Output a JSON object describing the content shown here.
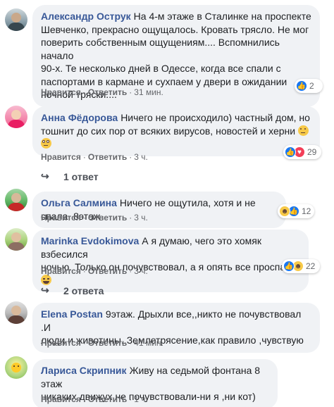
{
  "colors": {
    "author": "#385898",
    "bubble": "#f0f2f5",
    "meta": "#65676b",
    "like": "#1877f2",
    "love": "#f33e58",
    "haha": "#f7c948"
  },
  "comments": [
    {
      "author": "Александр Острук",
      "text_lines": [
        "На 4-м этаже в Сталинке на проспекте",
        "Шевченко, прекрасно ощущалось. Кровать трясло. Не мог",
        "поверить собственным ощущениям.... Вспомнились начало",
        "90-х. Те несколько дней в Одессе, когда все спали с",
        "паспортами в кармане и сухпаем у двери в ожидании",
        "ночной тряски...."
      ],
      "like": "Нравится",
      "reply": "Ответить",
      "time": "31 мин.",
      "reaction_icons": [
        "like-icon"
      ],
      "reaction_count": "2"
    },
    {
      "author": "Анна Фёдорова",
      "text_lines": [
        "Ничего не происходило) частный дом, но",
        "тошнит до сих пор от всяких вирусов, новостей и херни",
        ""
      ],
      "like": "Нравится",
      "reply": "Ответить",
      "time": "3 ч.",
      "reaction_icons": [
        "like-icon",
        "love-icon"
      ],
      "reaction_count": "29",
      "replies_label": "1 ответ"
    },
    {
      "author": "Ольга Салмина",
      "text_lines": [
        "Ничего не ощутила, хотя и не спала. 8этаж"
      ],
      "like": "Нравится",
      "reply": "Ответить",
      "time": "3 ч.",
      "reaction_icons": [
        "haha-icon",
        "like-icon"
      ],
      "reaction_count": "12"
    },
    {
      "author": "Marinka Evdokimova",
      "text_lines": [
        "А я думаю, чего это хомяк взбесился",
        "ночью. Только он почувствовал, а я опять все проспала."
      ],
      "like": "Нравится",
      "reply": "Ответить",
      "time": "3 ч.",
      "reaction_icons": [
        "like-icon",
        "haha-icon"
      ],
      "reaction_count": "22",
      "replies_label": "2 ответа"
    },
    {
      "author": "Elena Postan",
      "text_lines": [
        "9этаж. Дрыхли все,,никто не почувствовал .И",
        "люди и животины..Землетрясение,как правило ,чувствую"
      ],
      "like": "Нравится",
      "reply": "Ответить",
      "time": "41 мин."
    },
    {
      "author": "Лариса Скрипник",
      "text_lines": [
        "Живу на седьмой фонтана 8 этаж",
        "никаких движух не почувствовали-ни я ,ни кот)"
      ],
      "like": "Нравится",
      "reply": "Ответить",
      "time": "1 ч."
    }
  ]
}
